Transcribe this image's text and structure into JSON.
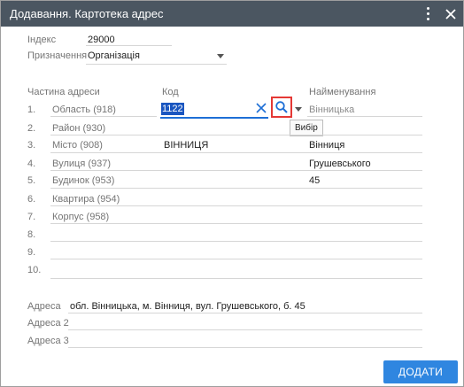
{
  "window": {
    "title": "Додавання. Картотека адрес",
    "menu_icon": "kebab-icon",
    "close_icon": "close-icon"
  },
  "form": {
    "index_label": "Індекс",
    "index_value": "29000",
    "purpose_label": "Призначення",
    "purpose_value": "Організація"
  },
  "table": {
    "headers": {
      "part": "Частина адреси",
      "code": "Код",
      "name": "Найменування"
    },
    "rows": [
      {
        "num": "1.",
        "part": "Область (918)",
        "code": "1122",
        "name": "Вінницька"
      },
      {
        "num": "2.",
        "part": "Район (930)",
        "code": "",
        "name": ""
      },
      {
        "num": "3.",
        "part": "Місто (908)",
        "code": "ВІННИЦЯ",
        "name": "Вінниця"
      },
      {
        "num": "4.",
        "part": "Вулиця (937)",
        "code": "",
        "name": "Грушевського"
      },
      {
        "num": "5.",
        "part": "Будинок (953)",
        "code": "",
        "name": "45"
      },
      {
        "num": "6.",
        "part": "Квартира (954)",
        "code": "",
        "name": ""
      },
      {
        "num": "7.",
        "part": "Корпус (958)",
        "code": "",
        "name": ""
      },
      {
        "num": "8.",
        "part": "",
        "code": "",
        "name": ""
      },
      {
        "num": "9.",
        "part": "",
        "code": "",
        "name": ""
      },
      {
        "num": "10.",
        "part": "",
        "code": "",
        "name": ""
      }
    ],
    "tooltip": "Вибір"
  },
  "address": {
    "address_label": "Адреса",
    "address_value": "обл. Вінницька, м. Вінниця, вул. Грушевського, б. 45",
    "address2_label": "Адреса 2",
    "address3_label": "Адреса 3"
  },
  "actions": {
    "add_label": "ДОДАТИ"
  },
  "colors": {
    "titlebar": "#4b5661",
    "accent": "#2f86e0",
    "selection": "#1a56c0",
    "highlight_box": "#e53935"
  }
}
